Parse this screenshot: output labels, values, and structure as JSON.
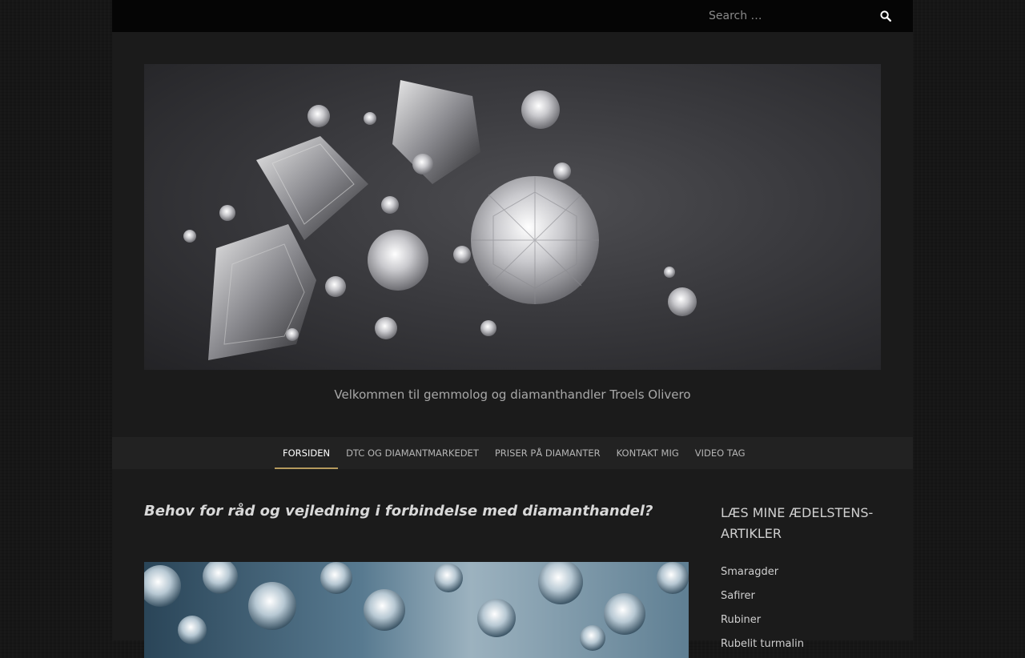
{
  "search": {
    "placeholder": "Search …",
    "icon": "search-icon"
  },
  "tagline": "Velkommen til gemmolog og diamanthandler Troels Olivero",
  "nav": {
    "items": [
      {
        "label": "FORSIDEN",
        "active": true
      },
      {
        "label": "DTC OG DIAMANTMARKEDET",
        "active": false
      },
      {
        "label": "PRISER PÅ DIAMANTER",
        "active": false
      },
      {
        "label": "KONTAKT MIG",
        "active": false
      },
      {
        "label": "VIDEO TAG",
        "active": false
      }
    ]
  },
  "main": {
    "title": "Behov for råd og vejledning i forbindelse med diamanthandel?"
  },
  "sidebar": {
    "title": "LÆS MINE ÆDELSTENS-ARTIKLER",
    "items": [
      {
        "label": "Smaragder"
      },
      {
        "label": "Safirer"
      },
      {
        "label": "Rubiner"
      },
      {
        "label": "Rubelit turmalin"
      }
    ]
  },
  "colors": {
    "page_bg": "#161616",
    "container_bg": "#1b1b1b",
    "topbar_bg": "#050505",
    "nav_bg": "#222222",
    "accent": "#b59a5d"
  }
}
